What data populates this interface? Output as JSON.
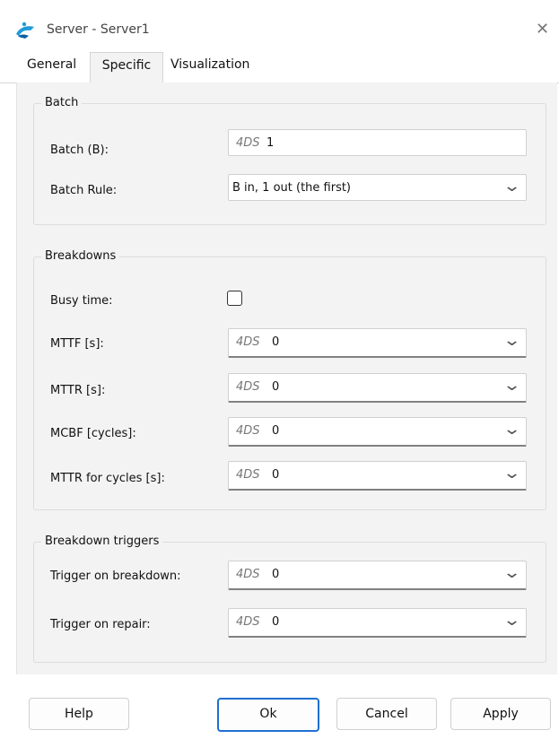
{
  "window": {
    "title": "Server - Server1",
    "close_glyph": "✕"
  },
  "tabs": [
    {
      "label": "General"
    },
    {
      "label": "Specific"
    },
    {
      "label": "Visualization"
    }
  ],
  "batch": {
    "legend": "Batch",
    "batch_label": "Batch (B):",
    "batch_value_ds": "4DS",
    "batch_value": "1",
    "rule_label": "Batch Rule:",
    "rule_value": "B in, 1 out (the first)"
  },
  "breakdowns": {
    "legend": "Breakdowns",
    "busy_label": "Busy time:",
    "busy_checked": false,
    "fields": [
      {
        "label": "MTTF [s]:",
        "ds": "4DS",
        "value": "0"
      },
      {
        "label": "MTTR [s]:",
        "ds": "4DS",
        "value": "0"
      },
      {
        "label": "MCBF [cycles]:",
        "ds": "4DS",
        "value": "0"
      },
      {
        "label": "MTTR for cycles [s]:",
        "ds": "4DS",
        "value": "0"
      }
    ]
  },
  "triggers": {
    "legend": "Breakdown triggers",
    "fields": [
      {
        "label": "Trigger on breakdown:",
        "ds": "4DS",
        "value": "0"
      },
      {
        "label": "Trigger on repair:",
        "ds": "4DS",
        "value": "0"
      }
    ]
  },
  "buttons": {
    "help": "Help",
    "ok": "Ok",
    "cancel": "Cancel",
    "apply": "Apply"
  },
  "icons": {
    "app": "app-icon",
    "close": "close-icon",
    "dropdown": "chevron-down-icon"
  },
  "colors": {
    "accent": "#1f6fd1",
    "panel": "#f3f3f3"
  }
}
